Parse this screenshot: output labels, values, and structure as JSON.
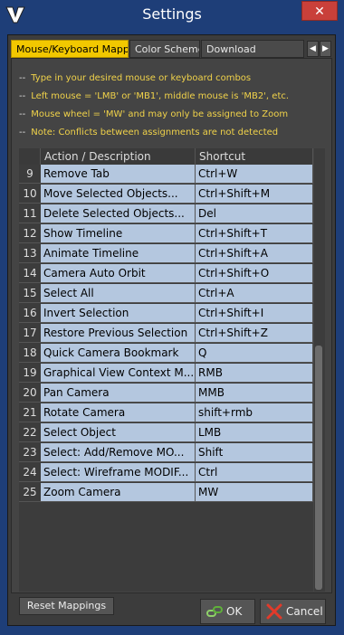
{
  "window": {
    "title": "Settings",
    "close_glyph": "✕"
  },
  "tabs": [
    {
      "label": "Mouse/Keyboard Mappings",
      "active": true
    },
    {
      "label": "Color Scheme",
      "active": false
    },
    {
      "label": "Download",
      "active": false
    }
  ],
  "tab_arrows": {
    "left": "◀",
    "right": "▶"
  },
  "info_lines": [
    "Type in your desired mouse or keyboard combos",
    "Left mouse = 'LMB' or 'MB1', middle mouse is 'MB2', etc.",
    "Mouse wheel = 'MW' and may only be assigned to Zoom",
    "Note: Conflicts between assignments are not detected"
  ],
  "info_dash": "--",
  "table": {
    "headers": [
      "Action / Description",
      "Shortcut"
    ],
    "rows": [
      {
        "num": "9",
        "action": "Remove Tab",
        "shortcut": "Ctrl+W"
      },
      {
        "num": "10",
        "action": "Move Selected Objects...",
        "shortcut": "Ctrl+Shift+M"
      },
      {
        "num": "11",
        "action": "Delete Selected Objects...",
        "shortcut": "Del"
      },
      {
        "num": "12",
        "action": "Show Timeline",
        "shortcut": "Ctrl+Shift+T"
      },
      {
        "num": "13",
        "action": "Animate Timeline",
        "shortcut": "Ctrl+Shift+A"
      },
      {
        "num": "14",
        "action": "Camera Auto Orbit",
        "shortcut": "Ctrl+Shift+O"
      },
      {
        "num": "15",
        "action": "Select All",
        "shortcut": "Ctrl+A"
      },
      {
        "num": "16",
        "action": "Invert Selection",
        "shortcut": "Ctrl+Shift+I"
      },
      {
        "num": "17",
        "action": "Restore Previous Selection",
        "shortcut": "Ctrl+Shift+Z"
      },
      {
        "num": "18",
        "action": "Quick Camera Bookmark",
        "shortcut": "Q"
      },
      {
        "num": "19",
        "action": "Graphical View Context M...",
        "shortcut": "RMB"
      },
      {
        "num": "20",
        "action": "Pan Camera",
        "shortcut": "MMB"
      },
      {
        "num": "21",
        "action": "Rotate Camera",
        "shortcut": "shift+rmb"
      },
      {
        "num": "22",
        "action": "Select Object",
        "shortcut": "LMB"
      },
      {
        "num": "23",
        "action": "Select: Add/Remove MO...",
        "shortcut": "Shift"
      },
      {
        "num": "24",
        "action": "Select: Wireframe MODIF...",
        "shortcut": "Ctrl"
      },
      {
        "num": "25",
        "action": "Zoom Camera",
        "shortcut": "MW"
      }
    ]
  },
  "buttons": {
    "reset": "Reset Mappings",
    "ok": "OK",
    "cancel": "Cancel"
  },
  "icons": {
    "app_logo": "v-logo-icon",
    "ok": "link-check-icon",
    "cancel": "red-x-icon"
  },
  "colors": {
    "title_bar": "#1e3e78",
    "active_tab": "#f2c800",
    "info_text": "#f0d24a",
    "cell_bg": "#b4c7df",
    "close_button": "#c9403a"
  }
}
